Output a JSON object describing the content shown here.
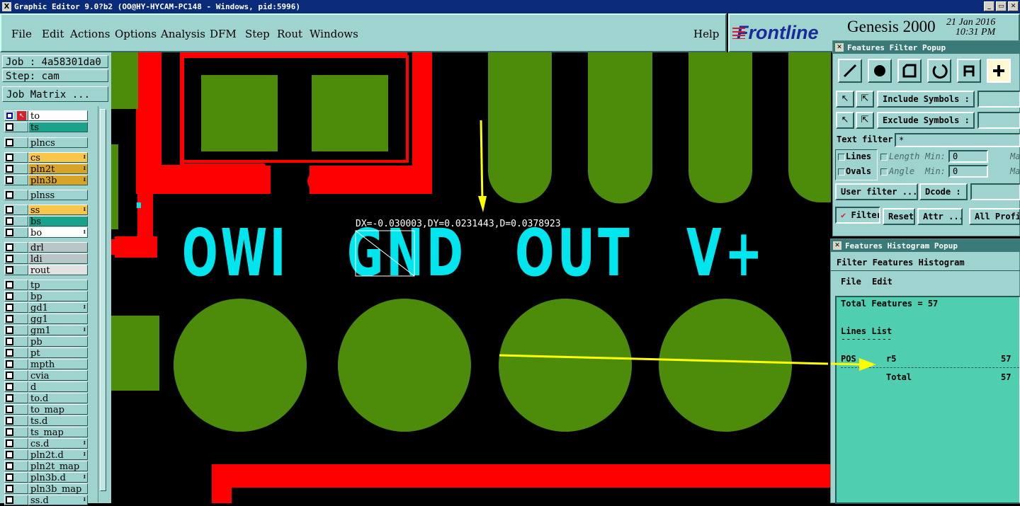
{
  "window": {
    "title": "Graphic Editor 9.0?b2 (OO@HY-HYCAM-PC148 - Windows, pid:5996)",
    "icon": "X",
    "controls": [
      "_",
      "▭",
      "✕"
    ]
  },
  "menu": {
    "file": "File",
    "edit": "Edit",
    "actions": "Actions",
    "options": "Options",
    "analysis": "Analysis",
    "dfm": "DFM",
    "step": "Step",
    "rout": "Rout",
    "windows": "Windows",
    "help": "Help"
  },
  "brand": {
    "logo": "Frontline",
    "product": "Genesis 2000",
    "date": "21 Jan 2016",
    "time": "10:31 PM"
  },
  "job": {
    "job": "Job : 4a58301da0",
    "step": "Step: cam",
    "matrix": "Job Matrix ..."
  },
  "layers": [
    {
      "name": "to",
      "color": "#ffffff",
      "state": "work"
    },
    {
      "name": "ts",
      "color": "#1aa38a"
    },
    {
      "name": "plncs",
      "color": "#9fd3cf"
    },
    {
      "name": "cs",
      "color": "#f7c64a",
      "icon": "ᵻ"
    },
    {
      "name": "pln2t",
      "color": "#d7a428",
      "icon": "ᵻ"
    },
    {
      "name": "pln3b",
      "color": "#d7a428",
      "icon": "ᵻ"
    },
    {
      "name": "plnss",
      "color": "#9fd3cf"
    },
    {
      "name": "ss",
      "color": "#f7c64a",
      "icon": "ᵻ"
    },
    {
      "name": "bs",
      "color": "#1aa38a"
    },
    {
      "name": "bo",
      "color": "#ffffff",
      "icon": "ᵻ"
    },
    {
      "name": "drl",
      "color": "#b9c6c8"
    },
    {
      "name": "ldi",
      "color": "#b9c6c8"
    },
    {
      "name": "rout",
      "color": "#e2e2e2"
    },
    {
      "name": "tp",
      "color": "#9fd3cf"
    },
    {
      "name": "bp",
      "color": "#9fd3cf"
    },
    {
      "name": "gd1",
      "color": "#9fd3cf",
      "icon": "ᵻ"
    },
    {
      "name": "gg1",
      "color": "#9fd3cf"
    },
    {
      "name": "gm1",
      "color": "#9fd3cf",
      "icon": "ᵻ"
    },
    {
      "name": "pb",
      "color": "#9fd3cf"
    },
    {
      "name": "pt",
      "color": "#9fd3cf"
    },
    {
      "name": "mpth",
      "color": "#9fd3cf"
    },
    {
      "name": "cvia",
      "color": "#9fd3cf"
    },
    {
      "name": "d",
      "color": "#9fd3cf"
    },
    {
      "name": "to.d",
      "color": "#9fd3cf"
    },
    {
      "name": "to_map",
      "color": "#9fd3cf"
    },
    {
      "name": "ts.d",
      "color": "#9fd3cf"
    },
    {
      "name": "ts_map",
      "color": "#9fd3cf"
    },
    {
      "name": "cs.d",
      "color": "#9fd3cf",
      "icon": "ᵻ"
    },
    {
      "name": "pln2t.d",
      "color": "#9fd3cf",
      "icon": "ᵻ"
    },
    {
      "name": "pln2t_map",
      "color": "#9fd3cf"
    },
    {
      "name": "pln3b.d",
      "color": "#9fd3cf",
      "icon": "ᵻ"
    },
    {
      "name": "pln3b_map",
      "color": "#9fd3cf"
    },
    {
      "name": "ss.d",
      "color": "#9fd3cf",
      "icon": "ᵻ"
    }
  ],
  "canvas": {
    "labels": [
      "OWI",
      "GND",
      "OUT",
      "V+"
    ],
    "measure": "DX=-0.030003,DY=0.0231443,D=0.0378923",
    "colors": {
      "copper": "#4c8c0a",
      "trace": "#ff0000",
      "text": "#00e5ee",
      "annotation": "#ffff00"
    }
  },
  "filter_popup": {
    "title": "Features Filter Popup",
    "include": "Include Symbols :",
    "exclude": "Exclude Symbols :",
    "text_filter": "Text filter",
    "text_value": "*",
    "lines": "Lines",
    "ovals": "Ovals",
    "length": "Length",
    "angle": "Angle",
    "min": "Min:",
    "min_value": "0",
    "max": "Ma",
    "user_filter": "User filter ...",
    "dcode": "Dcode :",
    "filter": "Filter",
    "reset": "Reset",
    "attr": "Attr ...",
    "all_profile": "All Profi"
  },
  "histogram_popup": {
    "title": "Features Histogram Popup",
    "header": "Filter Features Histogram",
    "file": "File",
    "edit": "Edit",
    "total_features": "Total Features = 57",
    "lines_list": "Lines List",
    "underline": "----------",
    "row_pos": "POS",
    "row_sym": "r5",
    "row_count": "57",
    "total_label": "Total",
    "total_count": "57"
  }
}
